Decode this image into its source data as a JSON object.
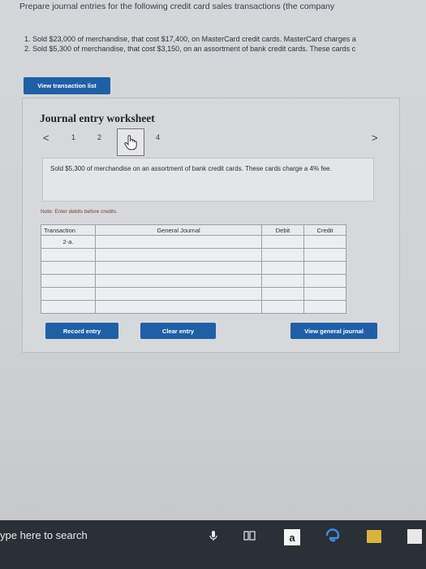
{
  "prompt": "Prepare journal entries for the following credit card sales transactions (the company",
  "items": [
    "1. Sold $23,000 of merchandise, that cost $17,400, on MasterCard credit cards. MasterCard charges a",
    "2. Sold $5,300 of merchandise, that cost $3,150, on an assortment of bank credit cards. These cards c"
  ],
  "buttons": {
    "view_transaction_list": "View transaction list",
    "record_entry": "Record entry",
    "clear_entry": "Clear entry",
    "view_general_journal": "View general journal"
  },
  "worksheet": {
    "title": "Journal entry worksheet",
    "nav": {
      "prev": "<",
      "p1": "1",
      "p2": "2",
      "p4": "4",
      "next": ">"
    },
    "description": "Sold $5,300 of merchandise on an assortment of bank credit cards. These cards charge a 4% fee.",
    "note": "Note: Enter debits before credits."
  },
  "journal": {
    "headers": {
      "transaction": "Transaction",
      "general_journal": "General Journal",
      "debit": "Debit",
      "credit": "Credit"
    },
    "rows": [
      {
        "transaction": "2-a."
      },
      {
        "transaction": ""
      },
      {
        "transaction": ""
      },
      {
        "transaction": ""
      },
      {
        "transaction": ""
      },
      {
        "transaction": ""
      }
    ]
  },
  "taskbar": {
    "search_placeholder": "ype here to search",
    "amazon_letter": "a"
  },
  "colors": {
    "accent": "#1f5fa6",
    "taskbar": "#2b2f36"
  }
}
